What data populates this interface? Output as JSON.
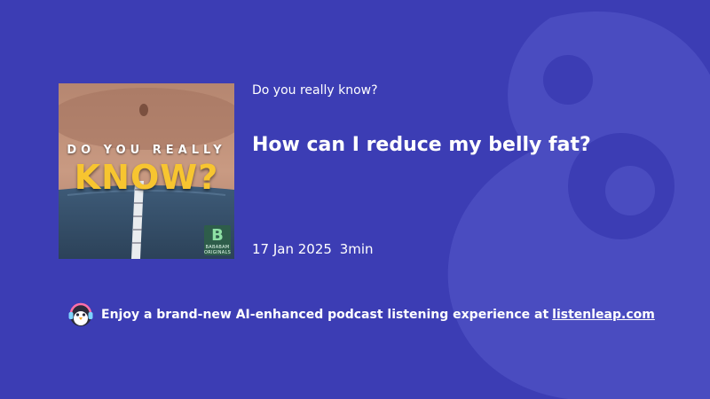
{
  "background": {
    "color": "#3c3db4",
    "watermark_icon": "listenleap-logo-watermark"
  },
  "cover": {
    "image": "belly-with-measuring-tape",
    "line1": "DO YOU REALLY",
    "line2": "KNOW?",
    "badge_mark": "B",
    "badge_text_1": "BABABAM",
    "badge_text_2": "ORIGINALS",
    "accent": "#f7c530"
  },
  "episode": {
    "show_name": "Do you really know?",
    "title": "How can I reduce my belly fat?",
    "date": "17 Jan 2025",
    "duration": "3min"
  },
  "promo": {
    "icon": "penguin-headphones-icon",
    "text": "Enjoy a brand-new AI-enhanced podcast listening experience at",
    "link": "listenleap.com"
  }
}
